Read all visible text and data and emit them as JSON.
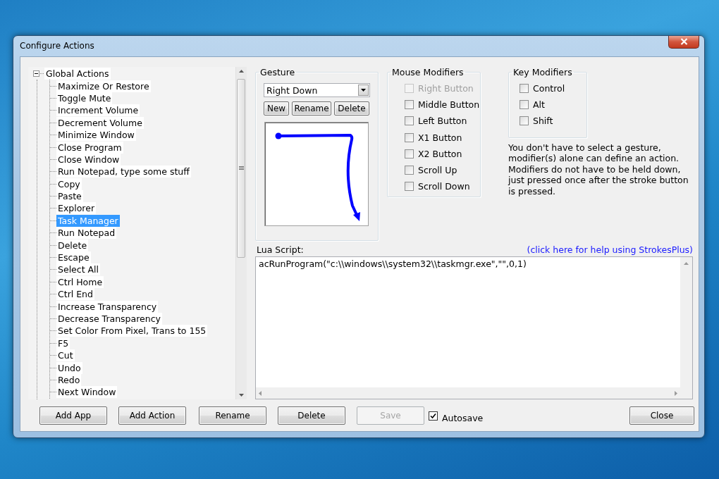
{
  "window": {
    "title": "Configure Actions"
  },
  "tree": {
    "root": {
      "label": "Global Actions",
      "expanded": true,
      "selected": false,
      "children": [
        {
          "label": "Maximize Or Restore",
          "selected": false
        },
        {
          "label": "Toggle Mute",
          "selected": false
        },
        {
          "label": "Increment Volume",
          "selected": false
        },
        {
          "label": "Decrement Volume",
          "selected": false
        },
        {
          "label": "Minimize Window",
          "selected": false
        },
        {
          "label": "Close Program",
          "selected": false
        },
        {
          "label": "Close Window",
          "selected": false
        },
        {
          "label": "Run Notepad, type some stuff",
          "selected": false
        },
        {
          "label": "Copy",
          "selected": false
        },
        {
          "label": "Paste",
          "selected": false
        },
        {
          "label": "Explorer",
          "selected": false
        },
        {
          "label": "Task Manager",
          "selected": true
        },
        {
          "label": "Run Notepad",
          "selected": false
        },
        {
          "label": "Delete",
          "selected": false
        },
        {
          "label": "Escape",
          "selected": false
        },
        {
          "label": "Select All",
          "selected": false
        },
        {
          "label": "Ctrl Home",
          "selected": false
        },
        {
          "label": "Ctrl End",
          "selected": false
        },
        {
          "label": "Increase Transparency",
          "selected": false
        },
        {
          "label": "Decrease Transparency",
          "selected": false
        },
        {
          "label": "Set Color From Pixel, Trans to 155",
          "selected": false
        },
        {
          "label": "F5",
          "selected": false
        },
        {
          "label": "Cut",
          "selected": false
        },
        {
          "label": "Undo",
          "selected": false
        },
        {
          "label": "Redo",
          "selected": false
        },
        {
          "label": "Next Window",
          "selected": false
        }
      ]
    }
  },
  "gesture": {
    "legend": "Gesture",
    "selected_gesture": "Right Down",
    "buttons": [
      {
        "label": "New"
      },
      {
        "label": "Rename"
      },
      {
        "label": "Delete"
      }
    ]
  },
  "mouse_modifiers": {
    "legend": "Mouse Modifiers",
    "items": [
      {
        "label": "Right Button",
        "checked": false,
        "disabled": true
      },
      {
        "label": "Middle Button",
        "checked": false,
        "disabled": false
      },
      {
        "label": "Left Button",
        "checked": false,
        "disabled": false
      },
      {
        "label": "X1 Button",
        "checked": false,
        "disabled": false
      },
      {
        "label": "X2 Button",
        "checked": false,
        "disabled": false
      },
      {
        "label": "Scroll Up",
        "checked": false,
        "disabled": false
      },
      {
        "label": "Scroll Down",
        "checked": false,
        "disabled": false
      }
    ]
  },
  "key_modifiers": {
    "legend": "Key Modifiers",
    "items": [
      {
        "label": "Control",
        "checked": false
      },
      {
        "label": "Alt",
        "checked": false
      },
      {
        "label": "Shift",
        "checked": false
      }
    ]
  },
  "help_text": "You don't have to select a gesture, modifier(s) alone can define an action. Modifiers do not have to be held down, just pressed once after the stroke button is pressed.",
  "script": {
    "label": "Lua Script:",
    "help_link": "(click here for help using StrokesPlus)",
    "value": "acRunProgram(\"c:\\\\windows\\\\system32\\\\taskmgr.exe\",\"\",0,1)"
  },
  "buttons": [
    {
      "label": "Add App",
      "disabled": false
    },
    {
      "label": "Add Action",
      "disabled": false
    },
    {
      "label": "Rename",
      "disabled": false
    },
    {
      "label": "Delete",
      "disabled": false
    },
    {
      "label": "Save",
      "disabled": true
    }
  ],
  "autosave": {
    "label": "Autosave",
    "checked": true
  },
  "close_button": {
    "label": "Close"
  }
}
